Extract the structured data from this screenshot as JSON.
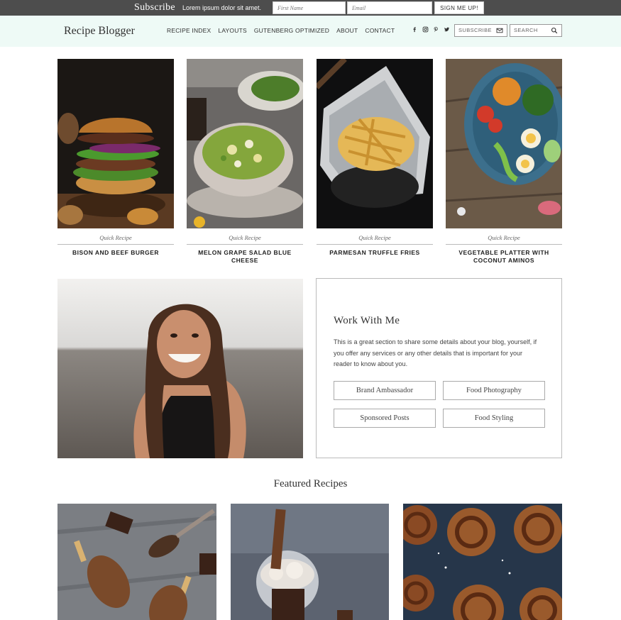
{
  "subscribe_bar": {
    "title": "Subscribe",
    "text": "Lorem ipsum dolor sit amet.",
    "first_name_placeholder": "First Name",
    "email_placeholder": "Email",
    "button_label": "SIGN ME UP!"
  },
  "header": {
    "logo": "Recipe Blogger",
    "nav": [
      "RECIPE INDEX",
      "LAYOUTS",
      "GUTENBERG OPTIMIZED",
      "ABOUT",
      "CONTACT"
    ],
    "social_icons": [
      "facebook-icon",
      "instagram-icon",
      "pinterest-icon",
      "twitter-icon"
    ],
    "subscribe_label": "SUBSCRIBE",
    "search_label": "SEARCH"
  },
  "recipes": [
    {
      "category": "Quick Recipe",
      "title": "BISON AND BEEF BURGER"
    },
    {
      "category": "Quick Recipe",
      "title": "MELON GRAPE SALAD BLUE CHEESE"
    },
    {
      "category": "Quick Recipe",
      "title": "PARMESAN TRUFFLE FRIES"
    },
    {
      "category": "Quick Recipe",
      "title": "VEGETABLE PLATTER WITH COCONUT AMINOS"
    }
  ],
  "work_with_me": {
    "title": "Work With Me",
    "description": "This is a great section to share some details about your blog, yourself, if you offer any services or any other details that is important for your reader to know about you.",
    "buttons": [
      "Brand Ambassador",
      "Food Photography",
      "Sponsored Posts",
      "Food Styling"
    ]
  },
  "featured": {
    "heading": "Featured Recipes"
  },
  "colors": {
    "topbar": "#4d4d4d",
    "header_bg": "#eefaf6",
    "text": "#333333",
    "border": "#bbbbbb"
  }
}
